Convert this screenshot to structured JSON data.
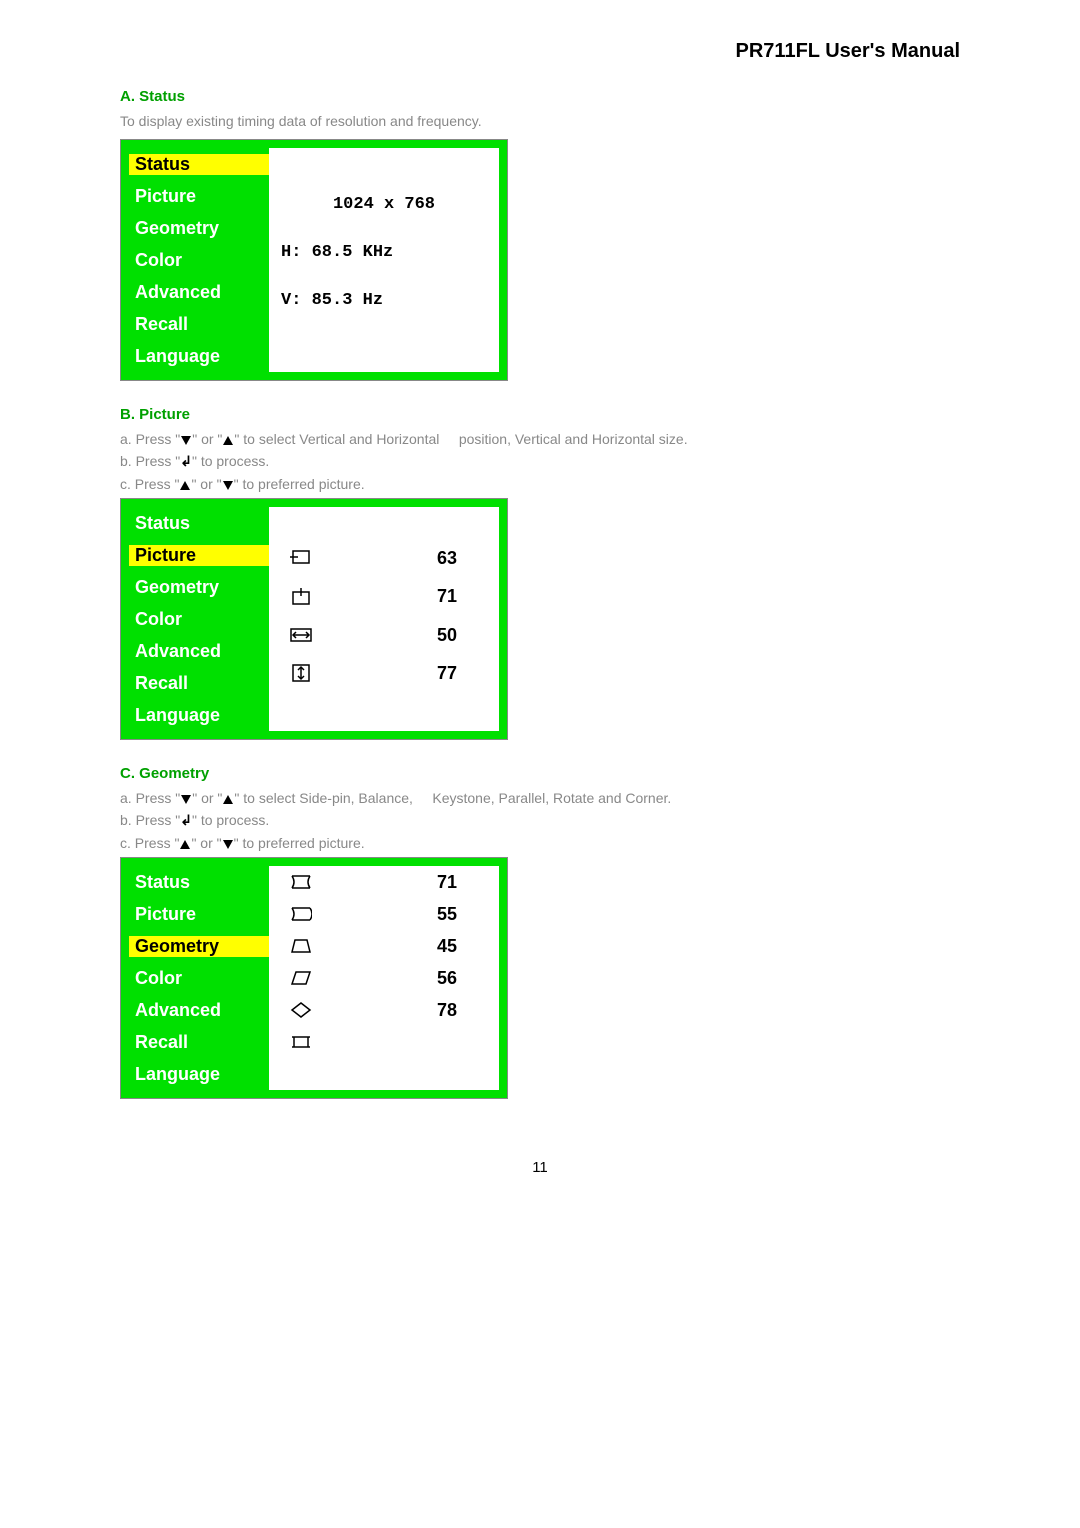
{
  "header": {
    "title": "PR711FL User's Manual"
  },
  "menu_labels": [
    "Status",
    "Picture",
    "Geometry",
    "Color",
    "Advanced",
    "Recall",
    "Language"
  ],
  "sectionA": {
    "heading": "A. Status",
    "desc": "To display existing timing data of resolution and frequency.",
    "status_lines": [
      "1024 x 768",
      "H: 68.5 KHz",
      "V: 85.3   Hz"
    ]
  },
  "sectionB": {
    "heading": "B. Picture",
    "step_a_pre": "a. Press \"",
    "step_a_mid": "\" or \"",
    "step_a_post": "\" to select Vertical and Horizontal",
    "step_a_extra": "position, Vertical and Horizontal size.",
    "step_b_pre": "b. Press \"",
    "step_b_post": "\" to process.",
    "step_c_pre": "c. Press \"",
    "step_c_mid": "\" or \"",
    "step_c_post": "\" to preferred picture.",
    "values": [
      63,
      71,
      50,
      77
    ]
  },
  "sectionC": {
    "heading": "C. Geometry",
    "step_a_pre": "a. Press \"",
    "step_a_mid": "\" or \"",
    "step_a_post": "\" to select Side-pin, Balance,",
    "step_a_extra": "Keystone, Parallel, Rotate and Corner.",
    "step_b_pre": "b. Press \"",
    "step_b_post": "\" to process.",
    "step_c_pre": "c. Press \"",
    "step_c_mid": "\" or \"",
    "step_c_post": "\" to preferred picture.",
    "values": [
      71,
      55,
      45,
      56,
      78,
      ""
    ]
  },
  "page": "11"
}
